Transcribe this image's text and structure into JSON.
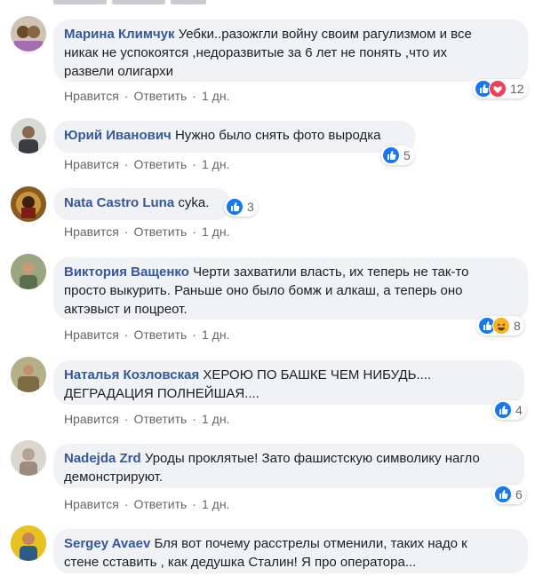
{
  "actions": {
    "like": "Нравится",
    "reply": "Ответить",
    "separator": "·"
  },
  "comments": [
    {
      "author": "Марина Климчук",
      "text": "Уебки..разожгли войну своим рагулизмом и все\nникак не успокоятся ,недоразвитые за 6 лет не понять ,что их\nразвели олигархи",
      "time": "1 дн.",
      "reactions": [
        "like",
        "heart"
      ],
      "count": "12"
    },
    {
      "author": "Юрий Иванович",
      "text": "Нужно было снять фото выродка",
      "time": "1 дн.",
      "reactions": [
        "like"
      ],
      "count": "5"
    },
    {
      "author": "Nata Castro Luna",
      "text": "cyka.",
      "time": "1 дн.",
      "reactions": [
        "like"
      ],
      "count": "3"
    },
    {
      "author": "Виктория Ващенко",
      "text": "Черти захватили власть, их теперь не так-то\nпросто выкурить. Раньше оно было бомж и алкаш, а теперь оно\nактэвыст и поцреот.",
      "time": "1 дн.",
      "reactions": [
        "like",
        "haha"
      ],
      "count": "8"
    },
    {
      "author": "Наталья Козловская",
      "text": "ХЕРОЮ ПО БАШКЕ ЧЕМ НИБУДЬ....\nДЕГРАДАЦИЯ ПОЛНЕЙШАЯ....",
      "time": "1 дн.",
      "reactions": [
        "like"
      ],
      "count": "4"
    },
    {
      "author": "Nadejda Zrd",
      "text": "Уроды проклятые! Зато фашистскую символику нагло\nдемонстрируют.",
      "time": "1 дн.",
      "reactions": [
        "like"
      ],
      "count": "6"
    },
    {
      "author": "Sergey Avaev",
      "text": "Бля вот почему расстрелы отменили, таких надо к\nстене сставить , как дедушка Сталин! Я про оператора...",
      "time": "",
      "reactions": [],
      "count": ""
    }
  ]
}
